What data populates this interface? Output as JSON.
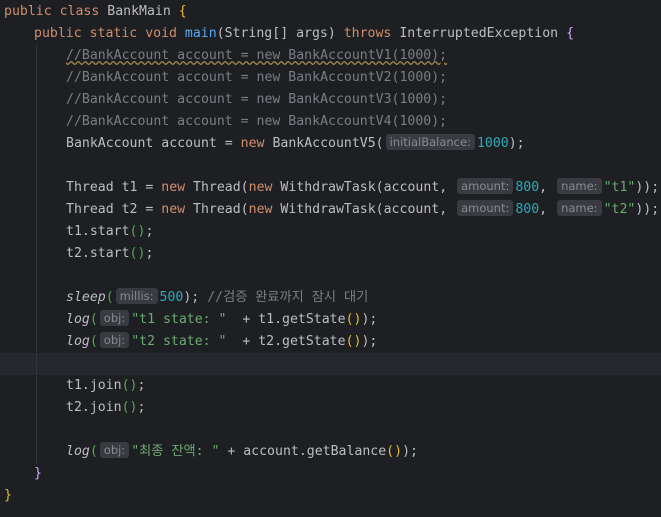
{
  "code": {
    "class_decl": {
      "kw_public": "public",
      "kw_class": "class",
      "class_name": "BankMain",
      "brace": "{"
    },
    "main_decl": {
      "kw_public": "public",
      "kw_static": "static",
      "kw_void": "void",
      "method": "main",
      "params": "(String[] args)",
      "kw_throws": "throws",
      "exception": "InterruptedException",
      "brace": "{"
    },
    "comments": [
      "//BankAccount account = new BankAccountV1(1000);",
      "//BankAccount account = new BankAccountV2(1000);",
      "//BankAccount account = new BankAccountV3(1000);",
      "//BankAccount account = new BankAccountV4(1000);"
    ],
    "account_line": {
      "decl": "BankAccount account = ",
      "kw_new": "new",
      "ctor": " BankAccountV5(",
      "hint": "initialBalance:",
      "value": "1000",
      "tail": ");"
    },
    "thread_lines": [
      {
        "decl": "Thread t1 = ",
        "kw_new1": "new",
        "ctor1": " Thread(",
        "kw_new2": "new",
        "ctor2": " WithdrawTask(account, ",
        "hint_amount": "amount:",
        "amount": "800",
        "sep": ", ",
        "hint_name": "name:",
        "name": "\"t1\"",
        "tail": "));"
      },
      {
        "decl": "Thread t2 = ",
        "kw_new1": "new",
        "ctor1": " Thread(",
        "kw_new2": "new",
        "ctor2": " WithdrawTask(account, ",
        "hint_amount": "amount:",
        "amount": "800",
        "sep": ", ",
        "hint_name": "name:",
        "name": "\"t2\"",
        "tail": "));"
      }
    ],
    "start_lines": [
      "t1.start",
      "t2.start"
    ],
    "sleep_line": {
      "fn": "sleep",
      "hint": "millis:",
      "value": "500",
      "tail": ");",
      "comment": "//검증 완료까지 잠시 대기"
    },
    "log_lines": [
      {
        "fn": "log",
        "hint": "obj:",
        "str": "\"t1 state: \"",
        "rest": "  + t1.getState",
        "tail": ");"
      },
      {
        "fn": "log",
        "hint": "obj:",
        "str": "\"t2 state: \"",
        "rest": "  + t2.getState",
        "tail": ");"
      }
    ],
    "join_lines": [
      "t1.join",
      "t2.join"
    ],
    "balance_line": {
      "fn": "log",
      "hint": "obj:",
      "str": "\"최종 잔액: \"",
      "rest": " + account.getBalance",
      "tail": ");"
    },
    "close_method": "}",
    "close_class": "}"
  }
}
